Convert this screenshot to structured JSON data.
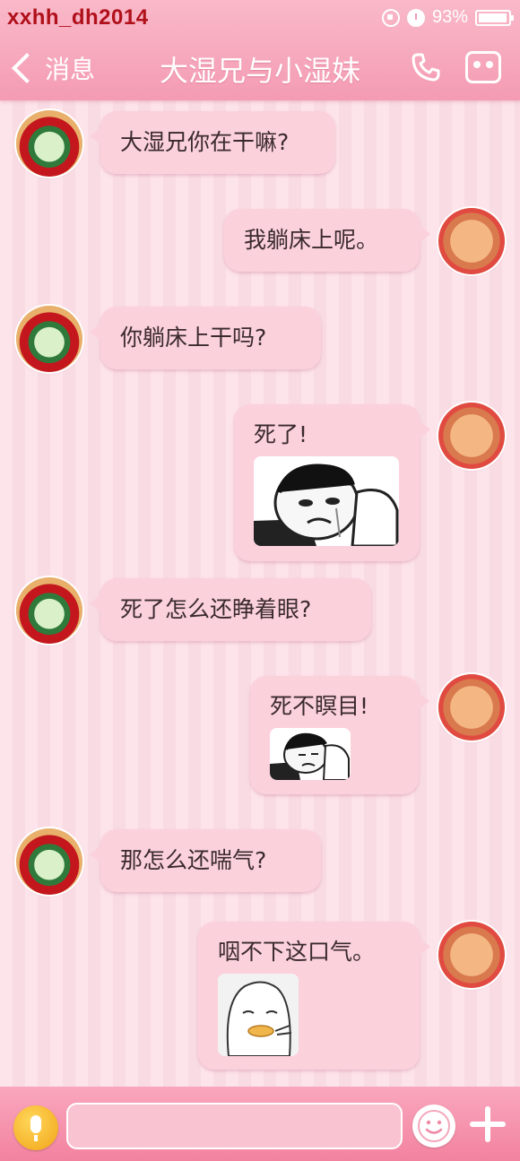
{
  "status_bar": {
    "watermark": "xxhh_dh2014",
    "battery": "93%",
    "battery_level": 0.93
  },
  "header": {
    "back_label": "消息",
    "title": "大湿兄与小湿妹"
  },
  "messages": [
    {
      "side": "left",
      "text": "大湿兄你在干嘛?"
    },
    {
      "side": "right",
      "text": "我躺床上呢。"
    },
    {
      "side": "left",
      "text": "你躺床上干吗?"
    },
    {
      "side": "right",
      "text": "死了!",
      "sticker": "crying-face-sticker"
    },
    {
      "side": "left",
      "text": "死了怎么还睁着眼?"
    },
    {
      "side": "right",
      "text": "死不瞑目!",
      "sticker": "lying-face-sticker"
    },
    {
      "side": "left",
      "text": "那怎么还喘气?"
    },
    {
      "side": "right",
      "text": "咽不下这口气。",
      "sticker": "duck-face-sticker"
    }
  ],
  "input": {
    "value": "",
    "placeholder": ""
  },
  "colors": {
    "header": "#f49bb3",
    "bubble": "#fbd1dc",
    "watermark": "#b0101a",
    "mic": "#f1a417"
  }
}
